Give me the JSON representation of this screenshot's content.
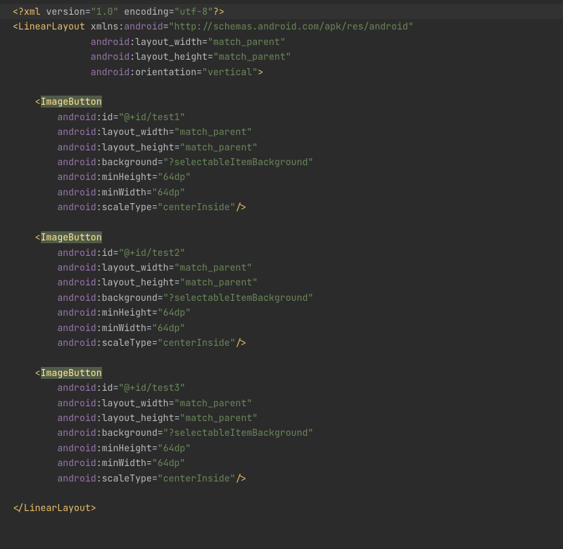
{
  "lang": "xml",
  "xml_decl": {
    "version": "1.0",
    "encoding": "utf-8"
  },
  "root": {
    "tag": "LinearLayout",
    "ns_decl": {
      "prefix": "xmlns",
      "name": "android",
      "value": "http://schemas.android.com/apk/res/android"
    },
    "attrs": [
      {
        "ns": "android",
        "name": "layout_width",
        "value": "match_parent"
      },
      {
        "ns": "android",
        "name": "layout_height",
        "value": "match_parent"
      },
      {
        "ns": "android",
        "name": "orientation",
        "value": "vertical"
      }
    ],
    "children": [
      {
        "tag": "ImageButton",
        "attrs": [
          {
            "ns": "android",
            "name": "id",
            "value": "@+id/test1"
          },
          {
            "ns": "android",
            "name": "layout_width",
            "value": "match_parent"
          },
          {
            "ns": "android",
            "name": "layout_height",
            "value": "match_parent"
          },
          {
            "ns": "android",
            "name": "background",
            "value": "?selectableItemBackground"
          },
          {
            "ns": "android",
            "name": "minHeight",
            "value": "64dp"
          },
          {
            "ns": "android",
            "name": "minWidth",
            "value": "64dp"
          },
          {
            "ns": "android",
            "name": "scaleType",
            "value": "centerInside"
          }
        ]
      },
      {
        "tag": "ImageButton",
        "attrs": [
          {
            "ns": "android",
            "name": "id",
            "value": "@+id/test2"
          },
          {
            "ns": "android",
            "name": "layout_width",
            "value": "match_parent"
          },
          {
            "ns": "android",
            "name": "layout_height",
            "value": "match_parent"
          },
          {
            "ns": "android",
            "name": "background",
            "value": "?selectableItemBackground"
          },
          {
            "ns": "android",
            "name": "minHeight",
            "value": "64dp"
          },
          {
            "ns": "android",
            "name": "minWidth",
            "value": "64dp"
          },
          {
            "ns": "android",
            "name": "scaleType",
            "value": "centerInside"
          }
        ]
      },
      {
        "tag": "ImageButton",
        "attrs": [
          {
            "ns": "android",
            "name": "id",
            "value": "@+id/test3"
          },
          {
            "ns": "android",
            "name": "layout_width",
            "value": "match_parent"
          },
          {
            "ns": "android",
            "name": "layout_height",
            "value": "match_parent"
          },
          {
            "ns": "android",
            "name": "background",
            "value": "?selectableItemBackground"
          },
          {
            "ns": "android",
            "name": "minHeight",
            "value": "64dp"
          },
          {
            "ns": "android",
            "name": "minWidth",
            "value": "64dp"
          },
          {
            "ns": "android",
            "name": "scaleType",
            "value": "centerInside"
          }
        ]
      }
    ]
  },
  "highlight_tag": "ImageButton",
  "caret_line_index": 0
}
